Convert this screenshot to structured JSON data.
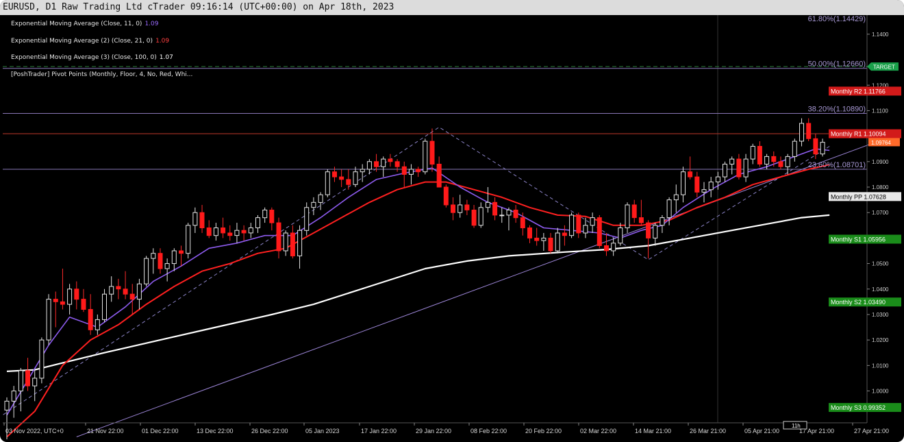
{
  "window": {
    "title": "EURUSD, D1 Raw Trading Ltd cTrader 09:16:14 (UTC+00:00) on Apr 18th, 2023"
  },
  "indicators": [
    {
      "label": "Exponential Moving Average (Close, 11, 0)",
      "value": "1.09",
      "color": "#9b6bff"
    },
    {
      "label": "Exponential Moving Average (2) (Close, 21, 0)",
      "value": "1.09",
      "color": "#ff3333"
    },
    {
      "label": "Exponential Moving Average (3) (Close, 100, 0)",
      "value": "1.07",
      "color": "#ffffff"
    },
    {
      "label": "[PoshTrader] Pivot Points (Monthly, Floor, 4, No, Red, Whi...",
      "value": "",
      "color": "#ffffff"
    }
  ],
  "chart_data": {
    "type": "candlestick",
    "symbol": "EURUSD",
    "timeframe": "D1",
    "ylim": [
      0.9875,
      1.1475
    ],
    "y_ticks": [
      "1.1400",
      "1.1200",
      "1.1100",
      "1.0900",
      "1.0800",
      "1.0700",
      "1.0500",
      "1.0400",
      "1.0300",
      "1.0200",
      "1.0100",
      "1.0000"
    ],
    "x_labels": [
      "03 Nov 2022, UTC+0",
      "21 Nov 22:00",
      "01 Dec 22:00",
      "13 Dec 22:00",
      "26 Dec 22:00",
      "05 Jan 2023",
      "17 Jan 22:00",
      "29 Jan 22:00",
      "08 Feb 22:00",
      "20 Feb 22:00",
      "02 Mar 22:00",
      "14 Mar 21:00",
      "26 Mar 21:00",
      "05 Apr 21:00",
      "17 Apr 21:00",
      "27 Apr 21:00"
    ],
    "current_price": {
      "label": "1.09764",
      "value": 1.09764,
      "color": "#ff6a2a"
    },
    "target": {
      "label": "TARGET",
      "value": 1.1273,
      "color": "#1aa04a"
    },
    "fib_levels": [
      {
        "label": "61.80%(1.14429)",
        "value": 1.14429,
        "line": false
      },
      {
        "label": "50.00%(1.12660)",
        "value": 1.1266,
        "line": true
      },
      {
        "label": "38.20%(1.10890)",
        "value": 1.1089,
        "line": true
      },
      {
        "label": "23.60%(1.08701)",
        "value": 1.08701,
        "line": true
      }
    ],
    "pivots": [
      {
        "name": "Monthly R2",
        "value_label": "1.11766",
        "value": 1.11766,
        "color": "#d21a1a"
      },
      {
        "name": "Monthly R1",
        "value_label": "1.10094",
        "value": 1.10094,
        "color": "#d21a1a"
      },
      {
        "name": "Monthly PP",
        "value_label": "1.07628",
        "value": 1.07628,
        "color": "#e8e8e8"
      },
      {
        "name": "Monthly S1",
        "value_label": "1.05956",
        "value": 1.05956,
        "color": "#1a8c1a"
      },
      {
        "name": "Monthly S2",
        "value_label": "1.03490",
        "value": 1.0349,
        "color": "#1a8c1a"
      },
      {
        "name": "Monthly S3",
        "value_label": "0.99352",
        "value": 0.99352,
        "color": "#1a8c1a"
      }
    ],
    "hover_badge": "11h",
    "candles": [
      [
        0.9925,
        0.9975,
        0.981,
        0.996
      ],
      [
        0.996,
        1.002,
        0.9895,
        1.0
      ],
      [
        1.0,
        1.009,
        0.992,
        1.008
      ],
      [
        1.008,
        1.013,
        1.0,
        1.002
      ],
      [
        1.002,
        1.008,
        0.996,
        1.005
      ],
      [
        1.005,
        1.021,
        1.003,
        1.02
      ],
      [
        1.02,
        1.038,
        1.018,
        1.036
      ],
      [
        1.036,
        1.039,
        1.025,
        1.035
      ],
      [
        1.035,
        1.048,
        1.032,
        1.034
      ],
      [
        1.034,
        1.042,
        1.03,
        1.04
      ],
      [
        1.04,
        1.043,
        1.032,
        1.036
      ],
      [
        1.036,
        1.04,
        1.031,
        1.032
      ],
      [
        1.032,
        1.038,
        1.022,
        1.024
      ],
      [
        1.024,
        1.03,
        1.022,
        1.028
      ],
      [
        1.028,
        1.04,
        1.027,
        1.038
      ],
      [
        1.038,
        1.045,
        1.035,
        1.041
      ],
      [
        1.041,
        1.044,
        1.036,
        1.04
      ],
      [
        1.04,
        1.047,
        1.036,
        1.038
      ],
      [
        1.038,
        1.042,
        1.03,
        1.036
      ],
      [
        1.036,
        1.044,
        1.032,
        1.042
      ],
      [
        1.042,
        1.053,
        1.041,
        1.052
      ],
      [
        1.052,
        1.056,
        1.046,
        1.054
      ],
      [
        1.054,
        1.056,
        1.046,
        1.048
      ],
      [
        1.048,
        1.052,
        1.043,
        1.05
      ],
      [
        1.05,
        1.056,
        1.047,
        1.055
      ],
      [
        1.055,
        1.057,
        1.049,
        1.054
      ],
      [
        1.054,
        1.066,
        1.052,
        1.065
      ],
      [
        1.065,
        1.072,
        1.062,
        1.07
      ],
      [
        1.07,
        1.073,
        1.062,
        1.064
      ],
      [
        1.064,
        1.067,
        1.06,
        1.061
      ],
      [
        1.061,
        1.066,
        1.059,
        1.064
      ],
      [
        1.064,
        1.068,
        1.06,
        1.062
      ],
      [
        1.062,
        1.065,
        1.059,
        1.061
      ],
      [
        1.061,
        1.066,
        1.058,
        1.063
      ],
      [
        1.063,
        1.065,
        1.059,
        1.062
      ],
      [
        1.062,
        1.066,
        1.06,
        1.064
      ],
      [
        1.064,
        1.069,
        1.062,
        1.068
      ],
      [
        1.068,
        1.072,
        1.066,
        1.071
      ],
      [
        1.071,
        1.072,
        1.063,
        1.066
      ],
      [
        1.066,
        1.068,
        1.052,
        1.055
      ],
      [
        1.055,
        1.063,
        1.053,
        1.062
      ],
      [
        1.062,
        1.065,
        1.052,
        1.053
      ],
      [
        1.053,
        1.065,
        1.048,
        1.063
      ],
      [
        1.063,
        1.074,
        1.061,
        1.072
      ],
      [
        1.072,
        1.076,
        1.069,
        1.074
      ],
      [
        1.074,
        1.078,
        1.071,
        1.077
      ],
      [
        1.077,
        1.087,
        1.076,
        1.086
      ],
      [
        1.086,
        1.088,
        1.082,
        1.084
      ],
      [
        1.084,
        1.087,
        1.08,
        1.083
      ],
      [
        1.083,
        1.087,
        1.079,
        1.081
      ],
      [
        1.081,
        1.088,
        1.08,
        1.086
      ],
      [
        1.086,
        1.089,
        1.082,
        1.087
      ],
      [
        1.087,
        1.091,
        1.085,
        1.09
      ],
      [
        1.09,
        1.093,
        1.086,
        1.088
      ],
      [
        1.088,
        1.092,
        1.084,
        1.091
      ],
      [
        1.091,
        1.093,
        1.088,
        1.09
      ],
      [
        1.09,
        1.091,
        1.086,
        1.088
      ],
      [
        1.088,
        1.09,
        1.08,
        1.085
      ],
      [
        1.085,
        1.089,
        1.081,
        1.087
      ],
      [
        1.087,
        1.088,
        1.084,
        1.086
      ],
      [
        1.086,
        1.099,
        1.085,
        1.098
      ],
      [
        1.098,
        1.103,
        1.086,
        1.089
      ],
      [
        1.089,
        1.092,
        1.08,
        1.08
      ],
      [
        1.08,
        1.081,
        1.072,
        1.073
      ],
      [
        1.073,
        1.076,
        1.067,
        1.07
      ],
      [
        1.07,
        1.077,
        1.068,
        1.073
      ],
      [
        1.073,
        1.075,
        1.069,
        1.071
      ],
      [
        1.071,
        1.073,
        1.064,
        1.065
      ],
      [
        1.065,
        1.074,
        1.064,
        1.072
      ],
      [
        1.072,
        1.08,
        1.07,
        1.074
      ],
      [
        1.074,
        1.076,
        1.067,
        1.069
      ],
      [
        1.069,
        1.072,
        1.066,
        1.069
      ],
      [
        1.069,
        1.072,
        1.063,
        1.071
      ],
      [
        1.071,
        1.073,
        1.066,
        1.068
      ],
      [
        1.068,
        1.07,
        1.061,
        1.064
      ],
      [
        1.064,
        1.065,
        1.058,
        1.06
      ],
      [
        1.06,
        1.064,
        1.057,
        1.059
      ],
      [
        1.059,
        1.062,
        1.055,
        1.06
      ],
      [
        1.06,
        1.062,
        1.054,
        1.055
      ],
      [
        1.055,
        1.064,
        1.054,
        1.062
      ],
      [
        1.062,
        1.065,
        1.057,
        1.061
      ],
      [
        1.061,
        1.07,
        1.06,
        1.069
      ],
      [
        1.069,
        1.07,
        1.06,
        1.062
      ],
      [
        1.062,
        1.068,
        1.06,
        1.065
      ],
      [
        1.065,
        1.07,
        1.062,
        1.068
      ],
      [
        1.068,
        1.069,
        1.056,
        1.057
      ],
      [
        1.057,
        1.062,
        1.053,
        1.055
      ],
      [
        1.055,
        1.06,
        1.053,
        1.058
      ],
      [
        1.058,
        1.066,
        1.057,
        1.064
      ],
      [
        1.064,
        1.074,
        1.062,
        1.073
      ],
      [
        1.073,
        1.075,
        1.066,
        1.068
      ],
      [
        1.068,
        1.075,
        1.065,
        1.066
      ],
      [
        1.066,
        1.067,
        1.052,
        1.06
      ],
      [
        1.06,
        1.066,
        1.057,
        1.065
      ],
      [
        1.065,
        1.069,
        1.062,
        1.068
      ],
      [
        1.068,
        1.076,
        1.065,
        1.075
      ],
      [
        1.075,
        1.081,
        1.07,
        1.077
      ],
      [
        1.077,
        1.088,
        1.074,
        1.086
      ],
      [
        1.086,
        1.092,
        1.083,
        1.084
      ],
      [
        1.084,
        1.086,
        1.076,
        1.078
      ],
      [
        1.078,
        1.082,
        1.074,
        1.079
      ],
      [
        1.079,
        1.084,
        1.076,
        1.082
      ],
      [
        1.082,
        1.086,
        1.079,
        1.084
      ],
      [
        1.084,
        1.09,
        1.082,
        1.089
      ],
      [
        1.089,
        1.092,
        1.085,
        1.091
      ],
      [
        1.091,
        1.093,
        1.083,
        1.084
      ],
      [
        1.084,
        1.093,
        1.082,
        1.091
      ],
      [
        1.091,
        1.097,
        1.089,
        1.096
      ],
      [
        1.096,
        1.098,
        1.088,
        1.089
      ],
      [
        1.089,
        1.093,
        1.087,
        1.092
      ],
      [
        1.092,
        1.094,
        1.088,
        1.09
      ],
      [
        1.09,
        1.092,
        1.087,
        1.088
      ],
      [
        1.088,
        1.093,
        1.085,
        1.092
      ],
      [
        1.092,
        1.099,
        1.09,
        1.098
      ],
      [
        1.098,
        1.107,
        1.096,
        1.105
      ],
      [
        1.105,
        1.107,
        1.098,
        1.099
      ],
      [
        1.099,
        1.101,
        1.091,
        1.093
      ],
      [
        1.093,
        1.099,
        1.092,
        1.0976
      ]
    ],
    "ema11": [
      [
        0,
        0.9905
      ],
      [
        6,
        1.018
      ],
      [
        9,
        1.029
      ],
      [
        13,
        1.025
      ],
      [
        17,
        1.033
      ],
      [
        21,
        1.043
      ],
      [
        25,
        1.049
      ],
      [
        29,
        1.056
      ],
      [
        33,
        1.058
      ],
      [
        37,
        1.061
      ],
      [
        41,
        1.061
      ],
      [
        45,
        1.068
      ],
      [
        49,
        1.076
      ],
      [
        53,
        1.083
      ],
      [
        57,
        1.0855
      ],
      [
        61,
        1.0875
      ],
      [
        65,
        1.08
      ],
      [
        69,
        1.074
      ],
      [
        73,
        1.07
      ],
      [
        77,
        1.064
      ],
      [
        81,
        1.063
      ],
      [
        85,
        1.062
      ],
      [
        88,
        1.06
      ],
      [
        91,
        1.063
      ],
      [
        94,
        1.065
      ],
      [
        97,
        1.072
      ],
      [
        101,
        1.079
      ],
      [
        105,
        1.085
      ],
      [
        109,
        1.088
      ],
      [
        113,
        1.092
      ],
      [
        116,
        1.095
      ],
      [
        118,
        1.0944
      ]
    ],
    "ema21": [
      [
        0,
        0.982
      ],
      [
        4,
        0.992
      ],
      [
        8,
        1.01
      ],
      [
        12,
        1.02
      ],
      [
        16,
        1.026
      ],
      [
        20,
        1.034
      ],
      [
        24,
        1.041
      ],
      [
        28,
        1.047
      ],
      [
        32,
        1.05
      ],
      [
        36,
        1.054
      ],
      [
        40,
        1.056
      ],
      [
        44,
        1.062
      ],
      [
        48,
        1.068
      ],
      [
        52,
        1.074
      ],
      [
        56,
        1.079
      ],
      [
        60,
        1.082
      ],
      [
        63,
        1.082
      ],
      [
        67,
        1.079
      ],
      [
        71,
        1.076
      ],
      [
        75,
        1.072
      ],
      [
        79,
        1.069
      ],
      [
        83,
        1.0685
      ],
      [
        87,
        1.065
      ],
      [
        91,
        1.065
      ],
      [
        95,
        1.067
      ],
      [
        99,
        1.072
      ],
      [
        103,
        1.076
      ],
      [
        107,
        1.081
      ],
      [
        111,
        1.084
      ],
      [
        115,
        1.087
      ],
      [
        118,
        1.0888
      ]
    ],
    "ema100": [
      [
        0,
        1.0077
      ],
      [
        4,
        1.0083
      ],
      [
        8,
        1.011
      ],
      [
        14,
        1.015
      ],
      [
        22,
        1.02
      ],
      [
        30,
        1.025
      ],
      [
        38,
        1.03
      ],
      [
        44,
        1.034
      ],
      [
        52,
        1.041
      ],
      [
        60,
        1.048
      ],
      [
        66,
        1.051
      ],
      [
        72,
        1.053
      ],
      [
        80,
        1.0545
      ],
      [
        86,
        1.0555
      ],
      [
        92,
        1.057
      ],
      [
        98,
        1.06
      ],
      [
        104,
        1.063
      ],
      [
        110,
        1.066
      ],
      [
        114,
        1.068
      ],
      [
        118,
        1.069
      ]
    ],
    "zigzag": [
      [
        -2,
        0.988
      ],
      [
        62,
        1.1035
      ],
      [
        92,
        1.0515
      ],
      [
        118,
        1.096
      ]
    ],
    "trendline": [
      [
        10,
        0.982
      ],
      [
        124,
        1.097
      ]
    ]
  }
}
